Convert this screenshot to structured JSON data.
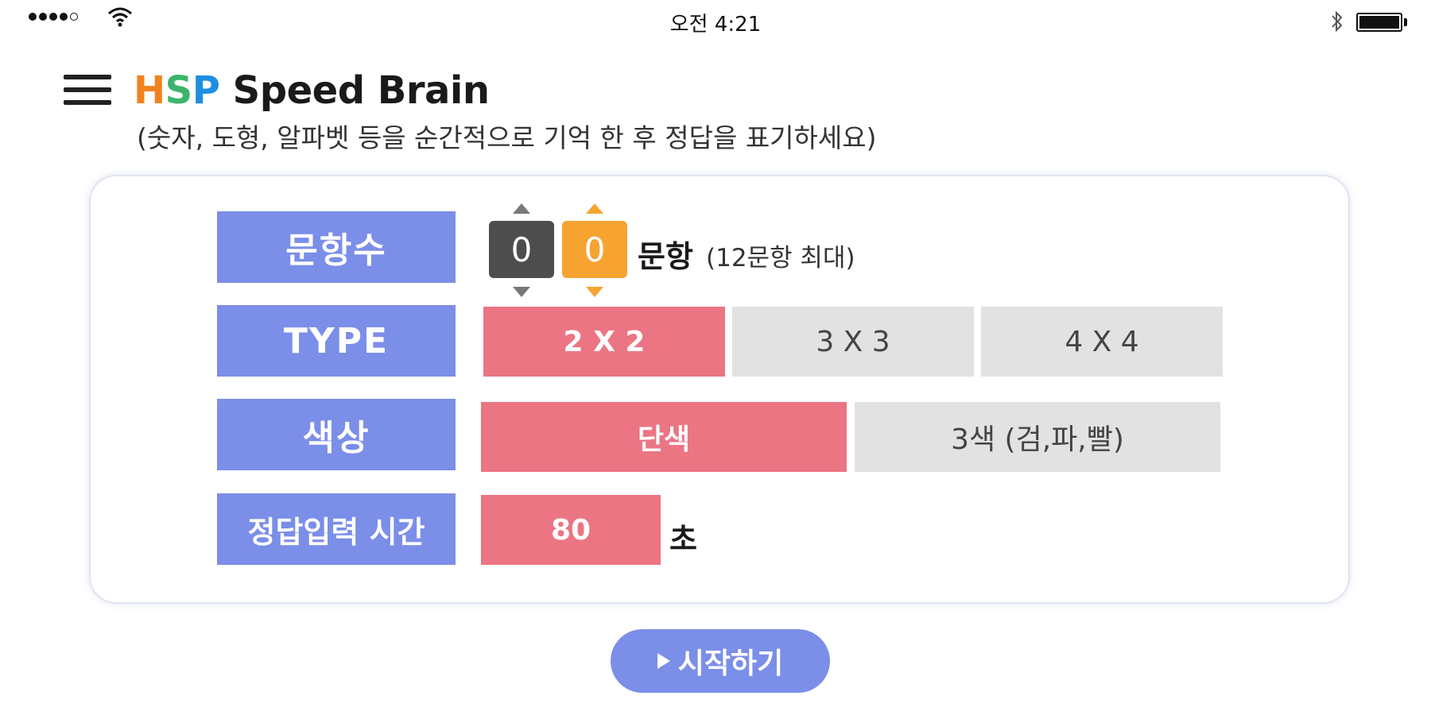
{
  "status_bar": {
    "time": "오전 4:21",
    "icons": [
      "signal-icon",
      "wifi-icon",
      "bluetooth-icon",
      "battery-icon"
    ]
  },
  "header": {
    "brand": {
      "h": "H",
      "s": "S",
      "p": "P",
      "rest": " Speed Brain"
    },
    "subtitle": "(숫자, 도형, 알파벳 등을 순간적으로 기억 한 후 정답을 표기하세요)"
  },
  "form": {
    "questions": {
      "label": "문항수",
      "digit_tens": "0",
      "digit_ones": "0",
      "unit": "문항",
      "note": "(12문항 최대)"
    },
    "type": {
      "label": "TYPE",
      "options": [
        "2 X 2",
        "3 X 3",
        "4 X 4"
      ],
      "selected": "2 X 2"
    },
    "color": {
      "label": "색상",
      "options": [
        "단색",
        "3색 (검,파,빨)"
      ],
      "selected": "단색"
    },
    "time": {
      "label": "정답입력 시간",
      "value": "80",
      "unit": "초"
    }
  },
  "start_button": {
    "label": "시작하기"
  },
  "colors": {
    "label_bg": "#7b8ee8",
    "active": "#eb7583",
    "inactive": "#e2e2e2",
    "digit_dark": "#4d4d4d",
    "digit_orange": "#f7a332"
  }
}
